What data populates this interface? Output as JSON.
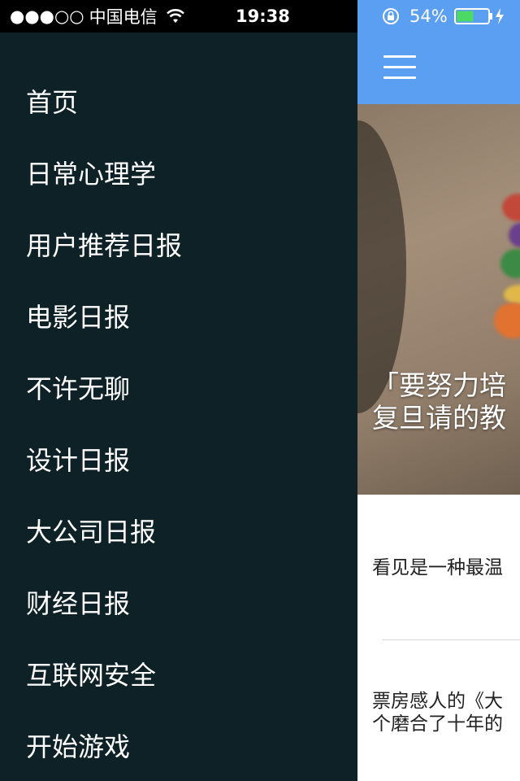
{
  "status_bar": {
    "signal_dots": "●●●○○",
    "carrier": "中国电信",
    "time": "19:38",
    "battery_percent": "54%",
    "battery_level": 0.54,
    "icons": [
      "wifi-icon",
      "rotation-lock-icon",
      "battery-icon",
      "charging-icon"
    ]
  },
  "drawer": {
    "items": [
      {
        "label": "首页"
      },
      {
        "label": "日常心理学"
      },
      {
        "label": "用户推荐日报"
      },
      {
        "label": "电影日报"
      },
      {
        "label": "不许无聊"
      },
      {
        "label": "设计日报"
      },
      {
        "label": "大公司日报"
      },
      {
        "label": "财经日报"
      },
      {
        "label": "互联网安全"
      },
      {
        "label": "开始游戏"
      }
    ]
  },
  "main": {
    "menu_icon": "hamburger-icon",
    "hero_title": "「要努力培\n复旦请的教",
    "stories": [
      {
        "title": "看见是一种最温"
      },
      {
        "title": "票房感人的《大\n个磨合了十年的"
      }
    ]
  },
  "colors": {
    "drawer_bg": "#0d2126",
    "accent_blue": "#5b9ff3",
    "status_bar_left": "#000000"
  }
}
